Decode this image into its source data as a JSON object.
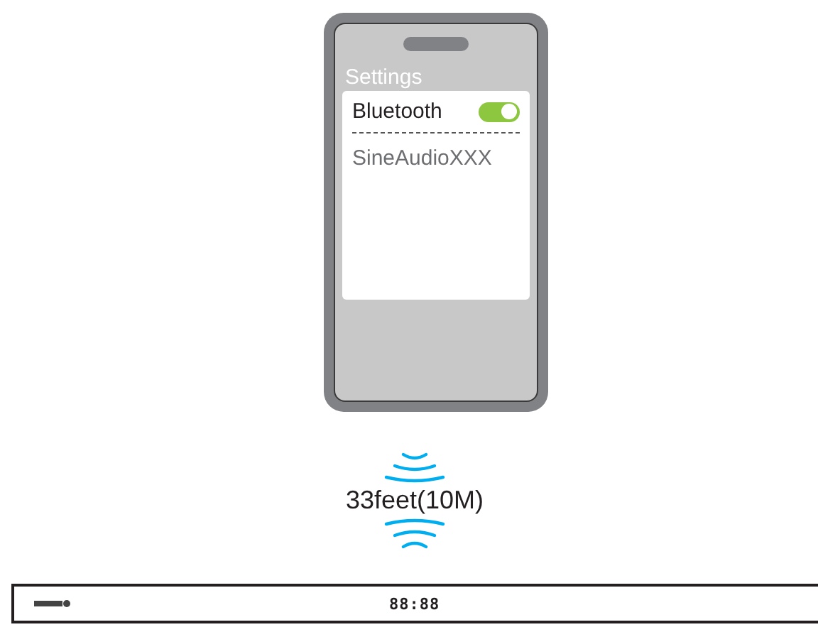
{
  "phone": {
    "header": "Settings",
    "toggle": {
      "label": "Bluetooth",
      "on": true
    },
    "devices": [
      "SineAudioXXX"
    ]
  },
  "range": "33feet(10M)",
  "soundbar": {
    "display": "88:88"
  }
}
